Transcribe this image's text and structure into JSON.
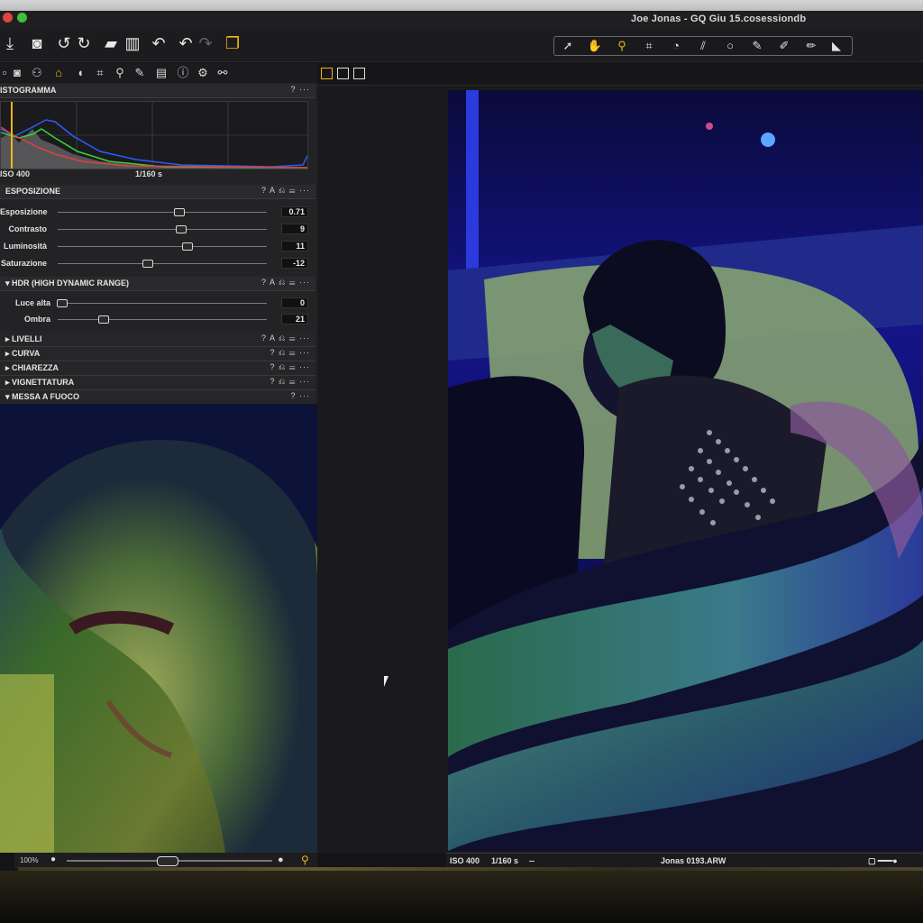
{
  "window": {
    "title": "Joe Jonas - GQ Giu 15.cosessiondb"
  },
  "colors": {
    "accent": "#f3b418",
    "panel": "#232325",
    "sky": "#1a24c8"
  },
  "toolbar": {
    "left_icons": [
      "import-icon",
      "camera-icon",
      "rotate-left-icon",
      "rotate-right-icon",
      "folder-icon",
      "trash-icon",
      "undo-all-icon",
      "undo-icon",
      "redo-icon",
      "variants-icon"
    ],
    "cursor_tools": [
      "select-icon",
      "pan-icon",
      "zoom-icon",
      "crop-icon",
      "rotate-icon",
      "keystone-icon",
      "spot-icon",
      "picker-icon",
      "brush-icon",
      "eraser-icon",
      "gradient-icon"
    ]
  },
  "tool_tabs": [
    "library-icon",
    "capture-icon",
    "color-icon",
    "exposure-icon",
    "lens-icon",
    "crop-icon",
    "focus-icon",
    "local-icon",
    "metadata-icon",
    "info-icon",
    "settings-icon",
    "batch-icon"
  ],
  "histogram": {
    "title": "ISTOGRAMMA",
    "iso": "ISO 400",
    "shutter": "1/160 s"
  },
  "exposure": {
    "title": "ESPOSIZIONE",
    "sliders": [
      {
        "label": "Esposizione",
        "value": "0.71",
        "pos": 0.58
      },
      {
        "label": "Contrasto",
        "value": "9",
        "pos": 0.59
      },
      {
        "label": "Luminosità",
        "value": "11",
        "pos": 0.62
      },
      {
        "label": "Saturazione",
        "value": "-12",
        "pos": 0.43
      }
    ]
  },
  "hdr": {
    "title": "HDR (HIGH DYNAMIC RANGE)",
    "sliders": [
      {
        "label": "Luce alta",
        "value": "0",
        "pos": 0.02
      },
      {
        "label": "Ombra",
        "value": "21",
        "pos": 0.22
      }
    ]
  },
  "sections": [
    "LIVELLI",
    "CURVA",
    "CHIAREZZA",
    "VIGNETTATURA",
    "MESSA A FUOCO"
  ],
  "zoom": {
    "level": "100%"
  },
  "status": {
    "iso": "ISO 400",
    "shutter": "1/160 s",
    "sep": "--",
    "filename": "Jonas 0193.ARW"
  }
}
